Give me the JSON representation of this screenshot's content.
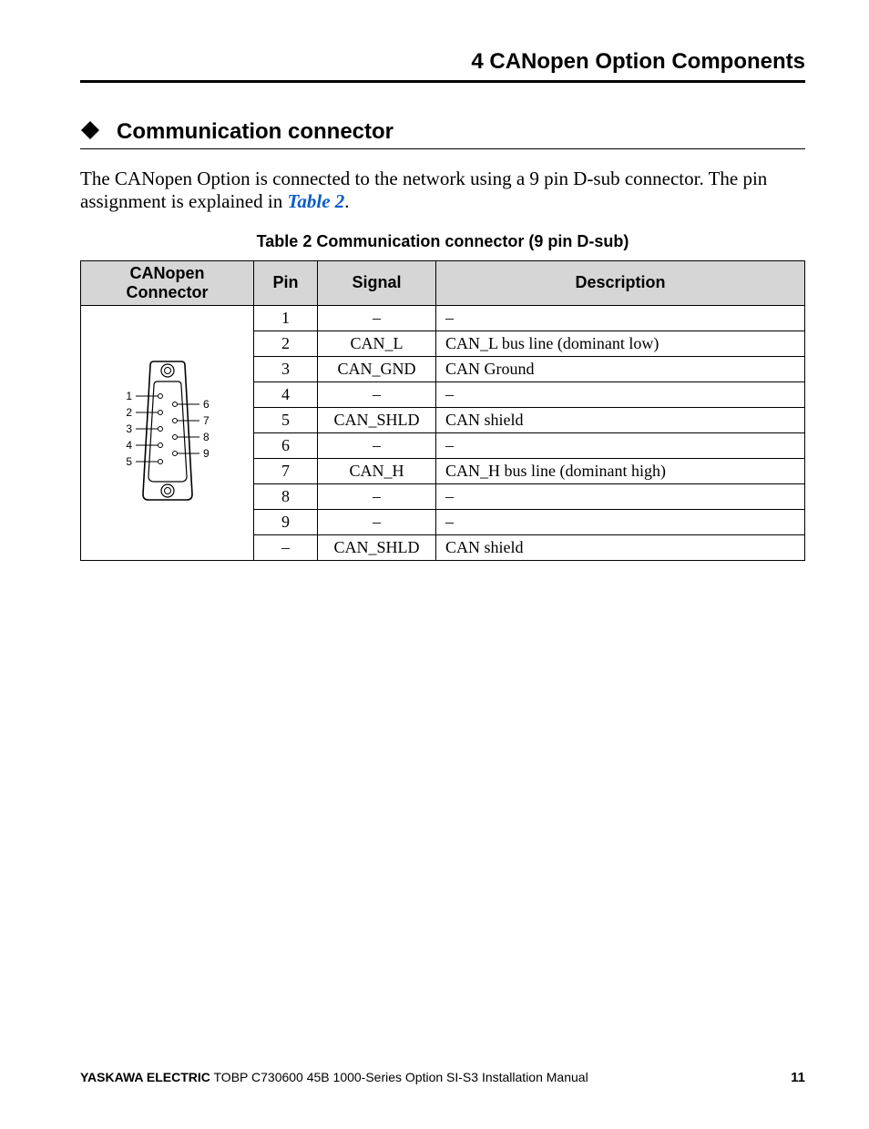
{
  "header": {
    "running_title": "4  CANopen Option Components"
  },
  "section": {
    "title": "Communication connector"
  },
  "paragraph": {
    "text_before_ref": "The CANopen Option is connected to the network using a 9 pin D-sub connector. The pin assignment is explained in ",
    "ref_label": "Table 2",
    "text_after_ref": "."
  },
  "table": {
    "caption": "Table 2  Communication connector (9 pin D-sub)",
    "headers": {
      "connector": "CANopen Connector",
      "pin": "Pin",
      "signal": "Signal",
      "description": "Description"
    },
    "rows": [
      {
        "pin": "1",
        "signal": "–",
        "description": "–"
      },
      {
        "pin": "2",
        "signal": "CAN_L",
        "description": "CAN_L bus line (dominant low)"
      },
      {
        "pin": "3",
        "signal": "CAN_GND",
        "description": "CAN Ground"
      },
      {
        "pin": "4",
        "signal": "–",
        "description": "–"
      },
      {
        "pin": "5",
        "signal": "CAN_SHLD",
        "description": "CAN shield"
      },
      {
        "pin": "6",
        "signal": "–",
        "description": "–"
      },
      {
        "pin": "7",
        "signal": "CAN_H",
        "description": "CAN_H bus line (dominant high)"
      },
      {
        "pin": "8",
        "signal": "–",
        "description": "–"
      },
      {
        "pin": "9",
        "signal": "–",
        "description": "–"
      },
      {
        "pin": "–",
        "signal": "CAN_SHLD",
        "description": "CAN shield"
      }
    ],
    "connector_pins_left": [
      "1",
      "2",
      "3",
      "4",
      "5"
    ],
    "connector_pins_right": [
      "6",
      "7",
      "8",
      "9"
    ]
  },
  "footer": {
    "brand": "YASKAWA ELECTRIC",
    "doc": " TOBP C730600 45B 1000-Series Option SI-S3 Installation Manual",
    "page": "11"
  }
}
